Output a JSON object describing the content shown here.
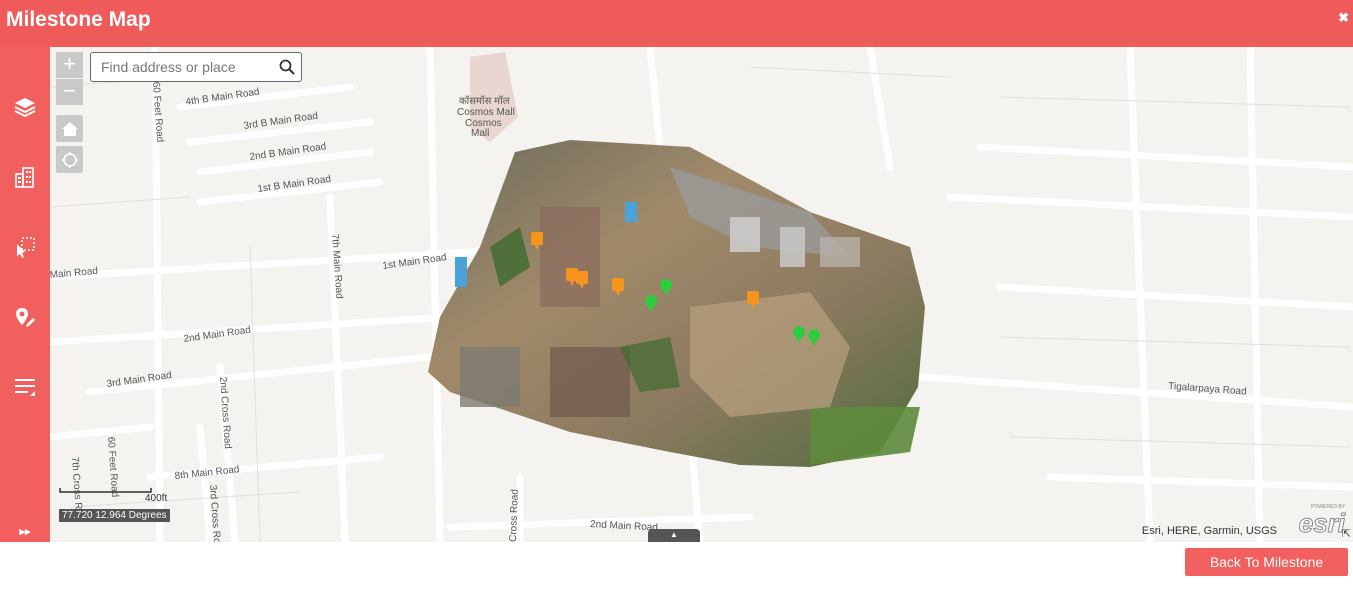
{
  "window": {
    "title": "Milestone Map",
    "close_symbol": "✖"
  },
  "sidebar": {
    "items": [
      {
        "icon": "layers-icon"
      },
      {
        "icon": "buildings-icon"
      },
      {
        "icon": "select-draw-icon"
      },
      {
        "icon": "location-edit-icon"
      },
      {
        "icon": "legend-list-icon"
      }
    ],
    "expand_symbol": "▸▸"
  },
  "map": {
    "zoom_in": "+",
    "zoom_out": "−",
    "search_placeholder": "Find address or place",
    "road_labels": [
      "4th B Main Road",
      "3rd B Main Road",
      "2nd B Main Road",
      "1st B Main Road",
      "60 Feet Road",
      "7th Main Road",
      "1st Main Road",
      "Main Road",
      "2nd Main Road",
      "3rd Main Road",
      "2nd Cross Road",
      "8th Main Road",
      "3rd Cross Road",
      "60 Feet Road",
      "7th Cross R",
      "Cross Road",
      "2nd Main Road",
      "Tigalarpaya Road"
    ],
    "poi_label": [
      "कॉसमॉस मॉल",
      "Cosmos Mall",
      "Cosmos",
      "Mall"
    ],
    "scale_label": "400ft",
    "coordinates": "77.720 12.964 Degrees",
    "attribution": "Esri, HERE, Garmin, USGS",
    "esri_powered": "POWERED BY",
    "esri_logo": "esri",
    "markers": [
      {
        "type": "orange"
      },
      {
        "type": "orange"
      },
      {
        "type": "orange"
      },
      {
        "type": "orange"
      },
      {
        "type": "orange"
      },
      {
        "type": "green"
      },
      {
        "type": "green"
      },
      {
        "type": "green"
      },
      {
        "type": "green"
      }
    ],
    "colors": {
      "orange_marker": "#f7941d",
      "green_marker": "#2ecc40"
    }
  },
  "footer": {
    "back_button": "Back To Milestone"
  },
  "colors": {
    "accent": "#ef5a5a",
    "map_bg": "#f4f3f0"
  }
}
